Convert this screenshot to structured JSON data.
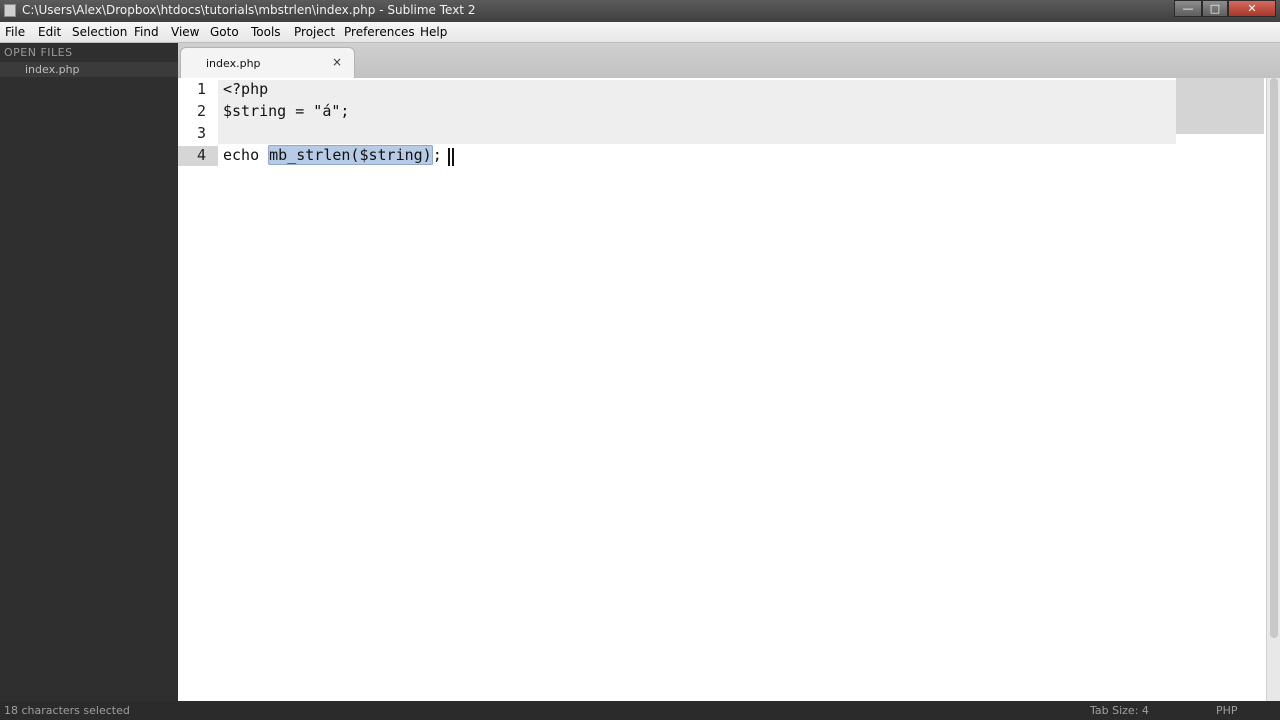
{
  "window": {
    "title": "C:\\Users\\Alex\\Dropbox\\htdocs\\tutorials\\mbstrlen\\index.php - Sublime Text 2",
    "minimize_glyph": "—",
    "maximize_glyph": "□",
    "close_glyph": "✕"
  },
  "menu": [
    "File",
    "Edit",
    "Selection",
    "Find",
    "View",
    "Goto",
    "Tools",
    "Project",
    "Preferences",
    "Help"
  ],
  "sidebar": {
    "header": "OPEN FILES",
    "files": [
      "index.php"
    ]
  },
  "tabs": [
    {
      "label": "index.php",
      "close_glyph": "×"
    }
  ],
  "editor": {
    "line_numbers": [
      "1",
      "2",
      "3",
      "4"
    ],
    "lines": {
      "l1": "<?php",
      "l2": "$string = \"á\";",
      "l3": "",
      "l4_before": "echo ",
      "l4_selected": "mb_strlen($string)",
      "l4_after": ";"
    }
  },
  "status": {
    "left": "18 characters selected",
    "tab_size": "Tab Size: 4",
    "syntax": "PHP"
  }
}
